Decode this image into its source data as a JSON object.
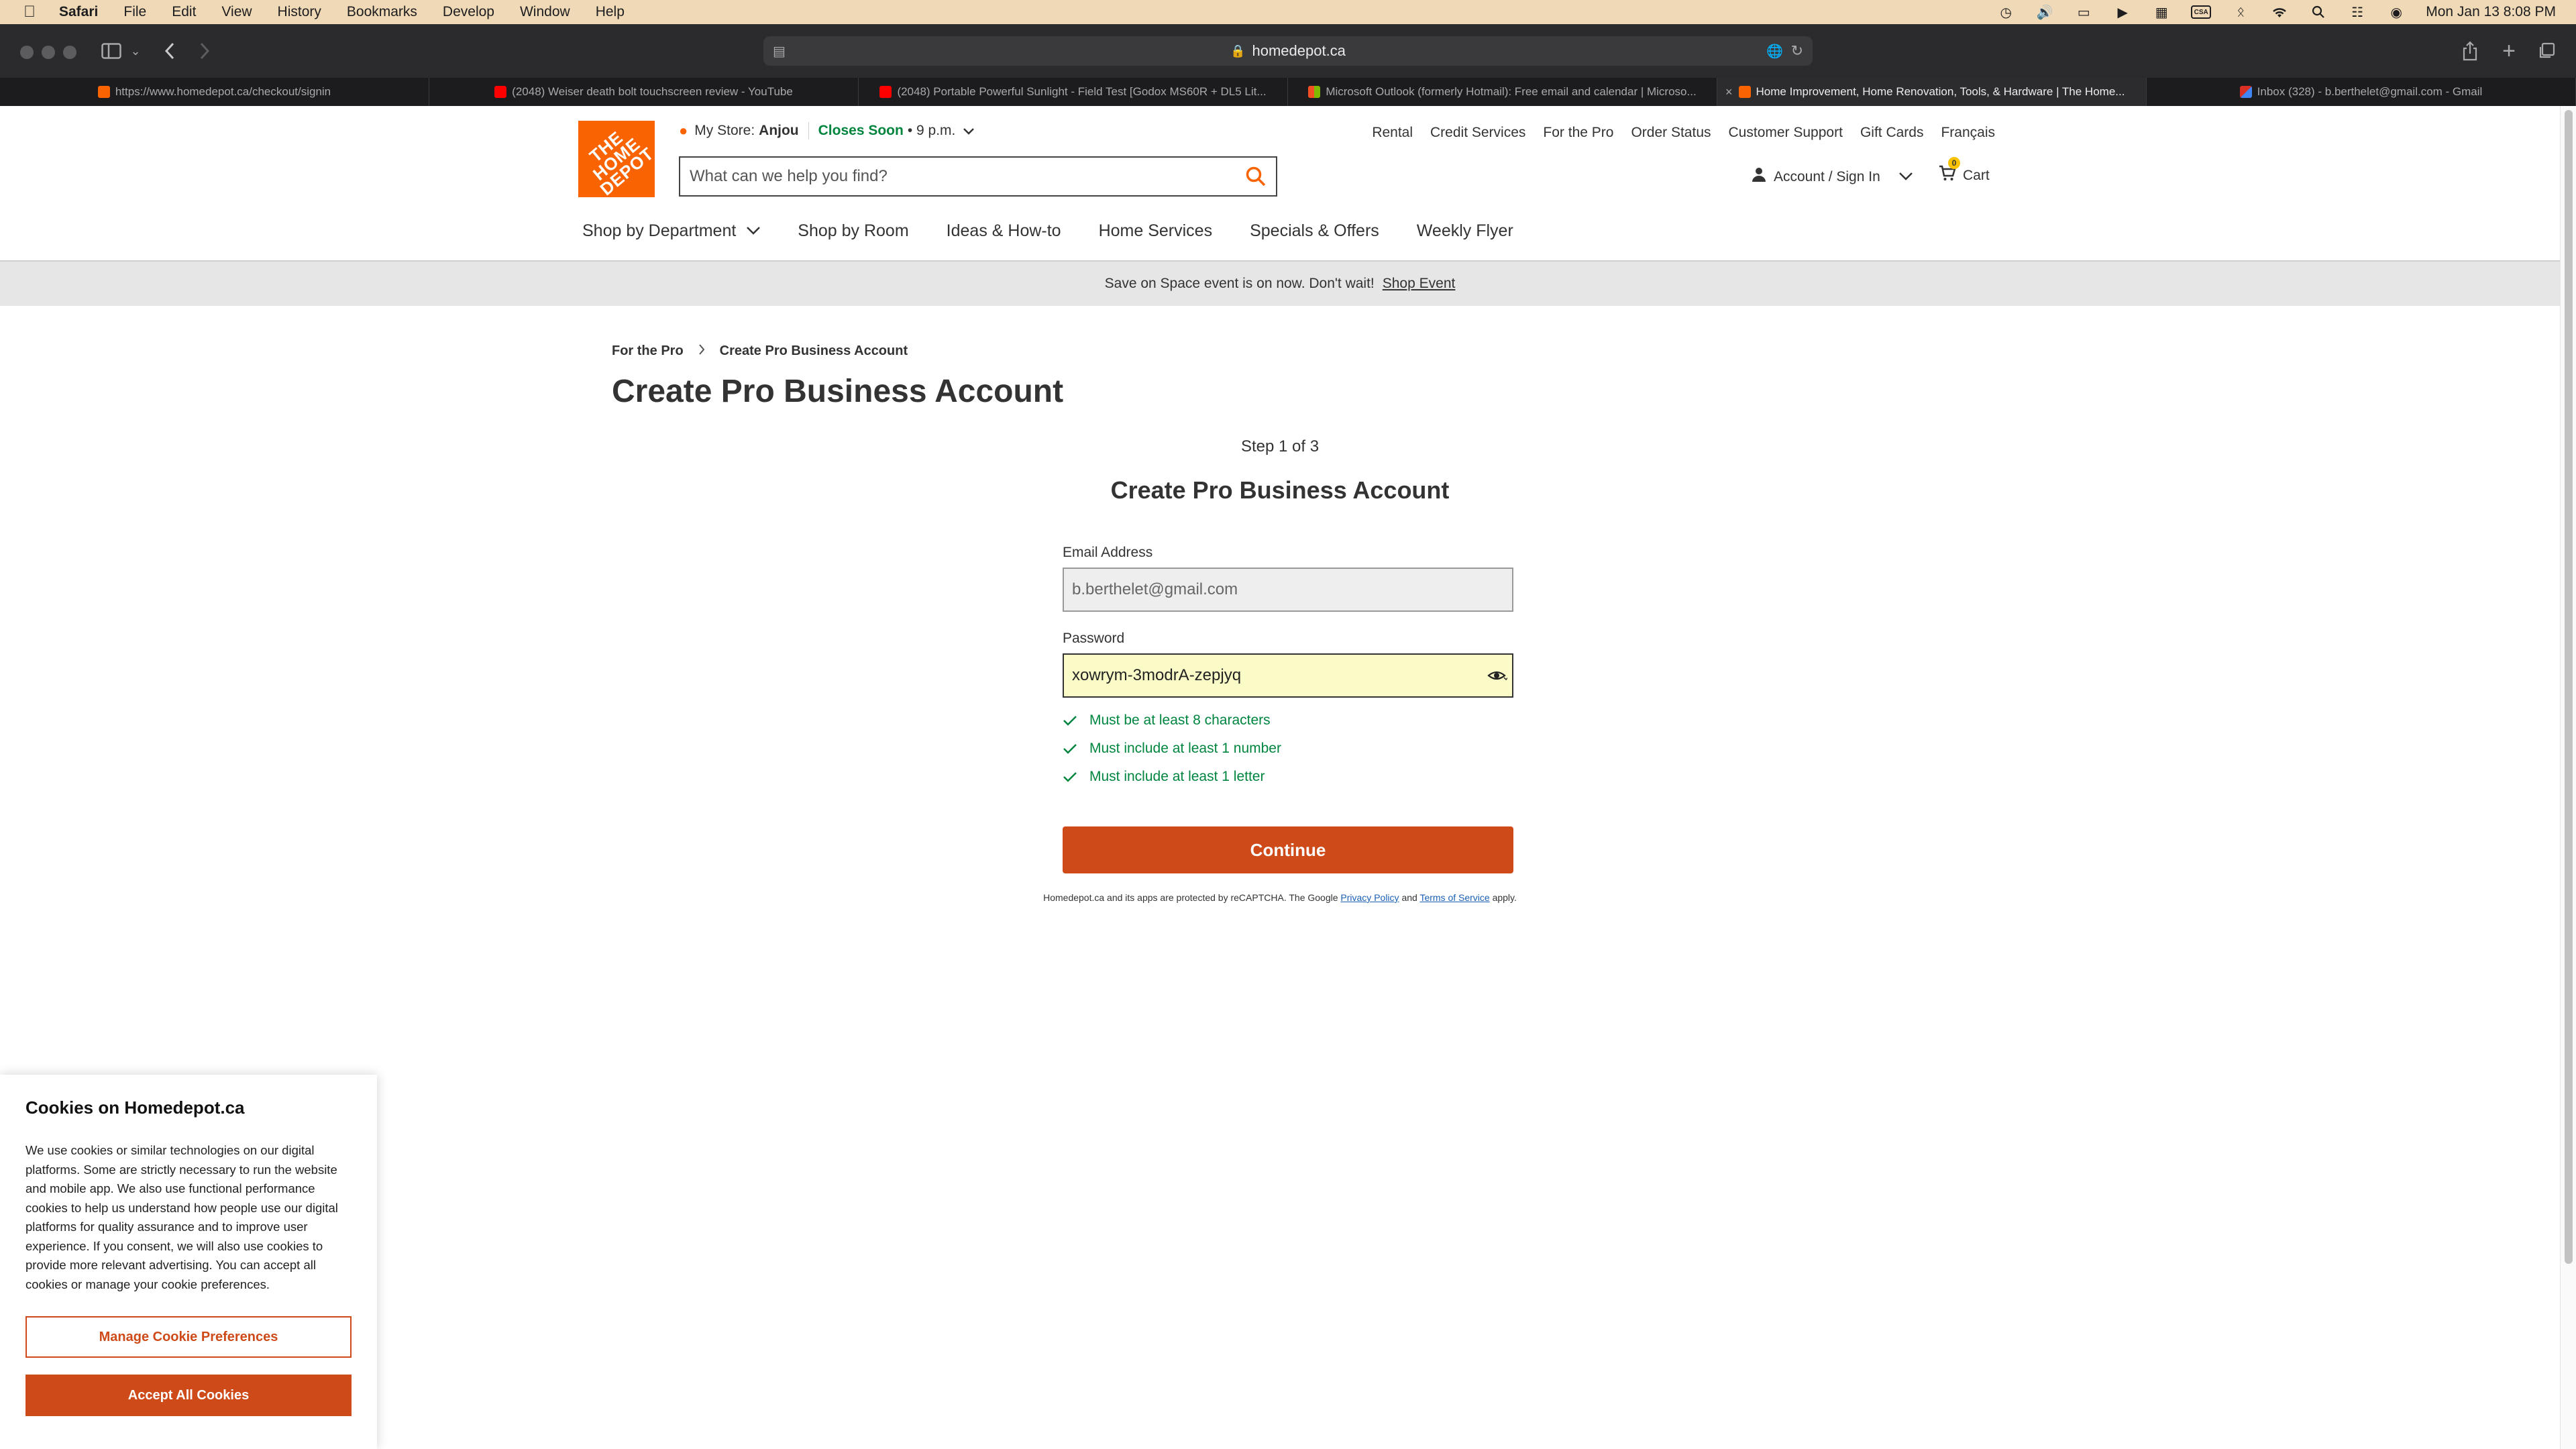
{
  "menubar": {
    "app": "Safari",
    "items": [
      "File",
      "Edit",
      "View",
      "History",
      "Bookmarks",
      "Develop",
      "Window",
      "Help"
    ],
    "clock": "Mon Jan 13  8:08 PM",
    "keyboard_badge": "CSA"
  },
  "browser": {
    "url": "homedepot.ca",
    "tabs": [
      {
        "title": "https://www.homedepot.ca/checkout/signin",
        "favicon_color": "#f96302"
      },
      {
        "title": "(2048) Weiser death bolt touchscreen review - YouTube",
        "favicon_color": "#ff0000"
      },
      {
        "title": "(2048) Portable Powerful Sunlight - Field Test [Godox MS60R + DL5 Lit...",
        "favicon_color": "#ff0000"
      },
      {
        "title": "Microsoft Outlook (formerly Hotmail): Free email and calendar | Microso...",
        "favicon_color": "#0078d4"
      },
      {
        "title": "Home Improvement, Home Renovation, Tools, & Hardware | The Home...",
        "favicon_color": "#f96302"
      },
      {
        "title": "Inbox (328) - b.berthelet@gmail.com - Gmail",
        "favicon_color": "#d93025"
      }
    ],
    "active_tab": 4
  },
  "header": {
    "logo_text": "THE HOME DEPOT",
    "store_label": "My Store:",
    "store_name": "Anjou",
    "closes_label": "Closes Soon",
    "closes_time": "• 9 p.m.",
    "search_placeholder": "What can we help you find?",
    "top_links": [
      "Rental",
      "Credit Services",
      "For the Pro",
      "Order Status",
      "Customer Support",
      "Gift Cards",
      "Français"
    ],
    "account_label": "Account / Sign In",
    "cart_label": "Cart",
    "cart_count": "0",
    "brand_color": "#f96302"
  },
  "nav": {
    "items": [
      "Shop by Department",
      "Shop by Room",
      "Ideas & How-to",
      "Home Services",
      "Specials & Offers",
      "Weekly Flyer"
    ]
  },
  "promo": {
    "text": "Save on Space event is on now. Don't wait!",
    "link": "Shop Event"
  },
  "main": {
    "breadcrumb": [
      "For the Pro",
      "Create Pro Business Account"
    ],
    "page_title": "Create Pro Business Account",
    "step": "Step 1 of 3",
    "form_title": "Create Pro Business Account",
    "email_label": "Email Address",
    "email_value": "b.berthelet@gmail.com",
    "password_label": "Password",
    "password_value": "xowrym-3modrA-zepjyq",
    "rules": [
      "Must be at least 8 characters",
      "Must include at least 1 number",
      "Must include at least 1 letter"
    ],
    "continue_label": "Continue",
    "recaptcha_prefix": "Homedepot.ca and its apps are protected by reCAPTCHA. The Google",
    "privacy_link": "Privacy Policy",
    "and_text": "and",
    "terms_link": "Terms of Service",
    "apply_text": "apply.",
    "accent_color": "#ce4a18",
    "success_color": "#00853f"
  },
  "cookie": {
    "title": "Cookies on Homedepot.ca",
    "body": "We use cookies or similar technologies on our digital platforms. Some are strictly necessary to run the website and mobile app. We also use functional performance cookies to help us understand how people use our digital platforms for quality assurance and to improve user experience. If you consent, we will also use cookies to provide more relevant advertising. You can accept all cookies or manage your cookie preferences.",
    "manage_label": "Manage Cookie Preferences",
    "accept_label": "Accept All Cookies"
  }
}
